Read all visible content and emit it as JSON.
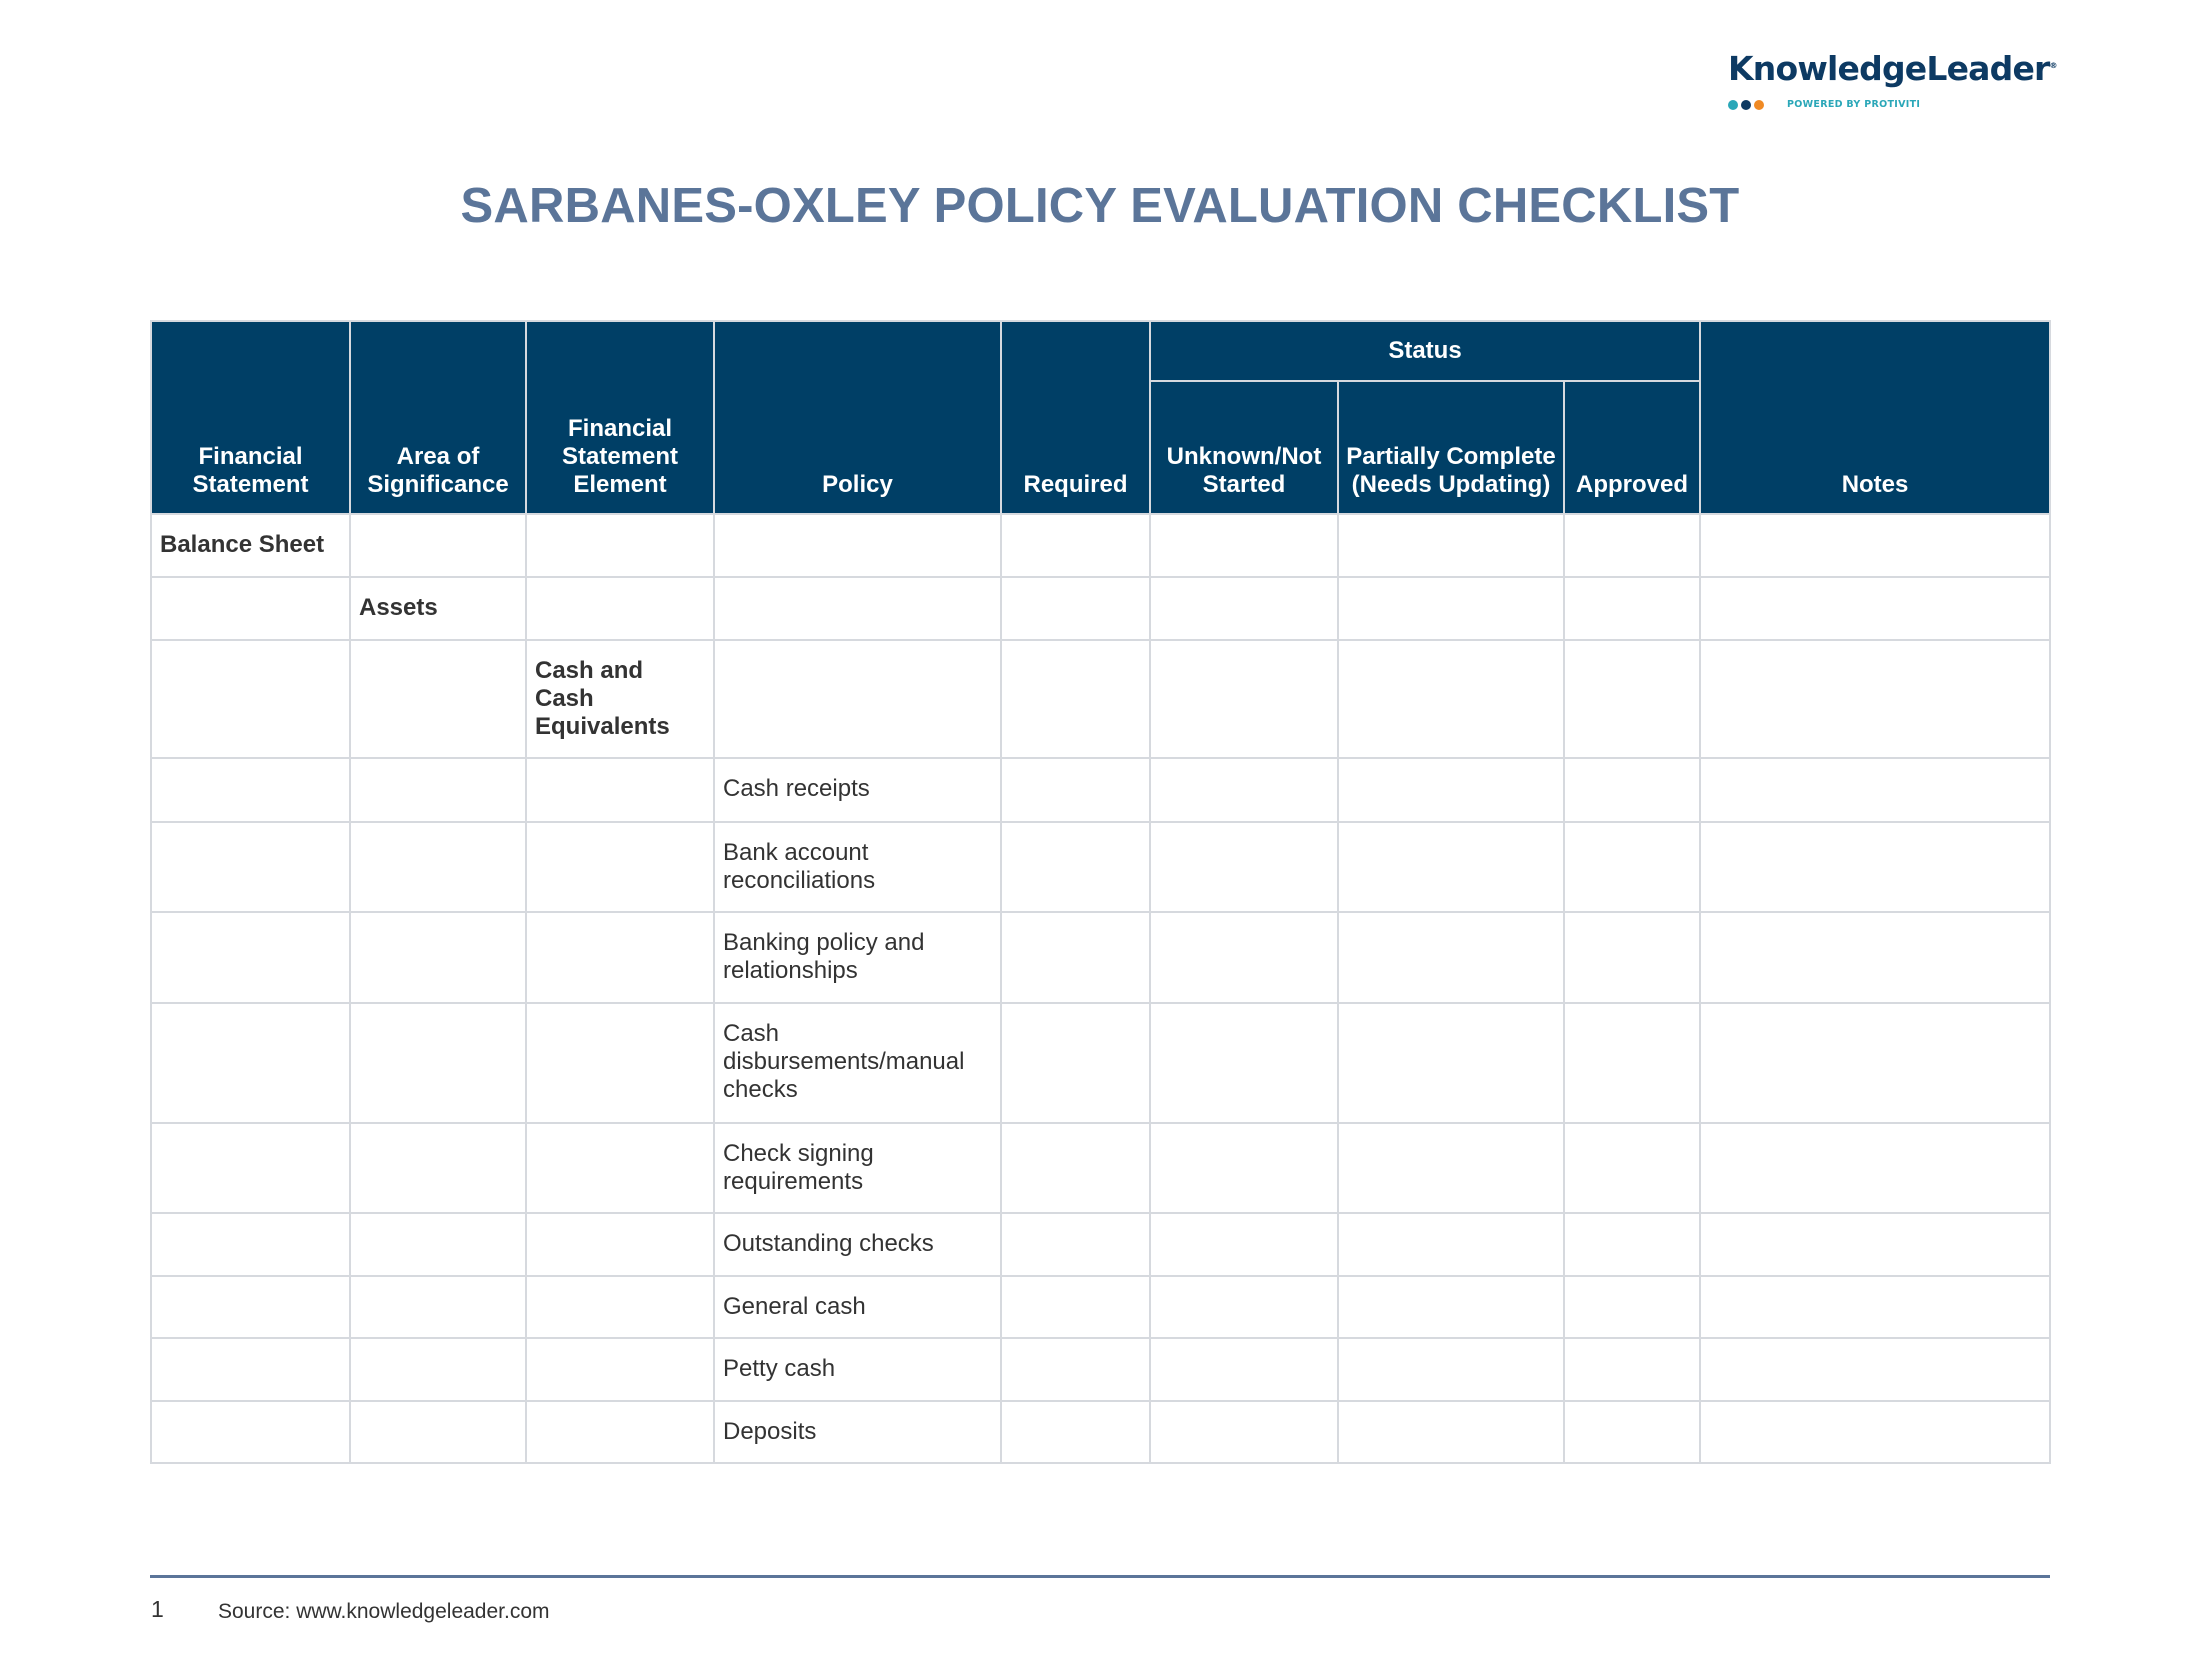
{
  "logo": {
    "wordmark": "KnowledgeLeader",
    "registered": "®",
    "tagline": "POWERED BY PROTIVITI",
    "dot_colors": [
      "#2aa7b8",
      "#0d3a63",
      "#f08a24"
    ]
  },
  "title": "SARBANES-OXLEY POLICY EVALUATION CHECKLIST",
  "colors": {
    "header_bg": "#003f66",
    "title": "#5b7599",
    "border": "#d6d9de"
  },
  "table": {
    "headers": {
      "financial_statement": "Financial Statement",
      "area_of_significance": "Area of Significance",
      "financial_statement_element": "Financial Statement Element",
      "policy": "Policy",
      "required": "Required",
      "status_group": "Status",
      "unknown_not_started": "Unknown/Not Started",
      "partially_complete": "Partially Complete (Needs Updating)",
      "approved": "Approved",
      "notes": "Notes"
    },
    "rows": [
      {
        "financial_statement": "Balance Sheet",
        "area": "",
        "element": "",
        "policy": ""
      },
      {
        "financial_statement": "",
        "area": "Assets",
        "element": "",
        "policy": ""
      },
      {
        "financial_statement": "",
        "area": "",
        "element": "Cash and Cash Equivalents",
        "policy": ""
      },
      {
        "financial_statement": "",
        "area": "",
        "element": "",
        "policy": "Cash receipts"
      },
      {
        "financial_statement": "",
        "area": "",
        "element": "",
        "policy": "Bank account reconciliations"
      },
      {
        "financial_statement": "",
        "area": "",
        "element": "",
        "policy": "Banking policy and relationships"
      },
      {
        "financial_statement": "",
        "area": "",
        "element": "",
        "policy": "Cash disbursements/manual checks"
      },
      {
        "financial_statement": "",
        "area": "",
        "element": "",
        "policy": "Check signing requirements"
      },
      {
        "financial_statement": "",
        "area": "",
        "element": "",
        "policy": "Outstanding checks"
      },
      {
        "financial_statement": "",
        "area": "",
        "element": "",
        "policy": "General cash"
      },
      {
        "financial_statement": "",
        "area": "",
        "element": "",
        "policy": "Petty cash"
      },
      {
        "financial_statement": "",
        "area": "",
        "element": "",
        "policy": "Deposits"
      }
    ]
  },
  "footer": {
    "page_number": "1",
    "source": "Source: www.knowledgeleader.com"
  }
}
